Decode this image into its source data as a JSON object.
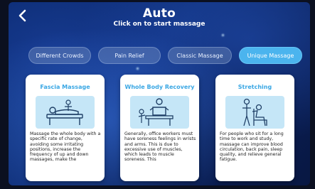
{
  "header": {
    "title": "Auto",
    "subtitle": "Click on to start massage",
    "back_icon": "chevron-left-icon"
  },
  "tabs": [
    {
      "label": "Different Crowds",
      "active": false
    },
    {
      "label": "Pain Relief",
      "active": false
    },
    {
      "label": "Classic Massage",
      "active": false
    },
    {
      "label": "Unique Massage",
      "active": true
    }
  ],
  "cards": [
    {
      "title": "Fascia Massage",
      "icon": "reclining-massage-icon",
      "description": "Massage the whole body with a specific rate of change, avoiding some irritating positions, increase the frequency of up and down massages, make the"
    },
    {
      "title": "Whole Body Recovery",
      "icon": "seated-massage-icon",
      "description": "Generally, office workers must have soreness feelings in wrists and arms. This is due to excessive use of muscles, which leads to muscle soreness. This"
    },
    {
      "title": "Stretching",
      "icon": "stretching-chair-icon",
      "description": "For people who sit for a long time to work and study, massage can improve blood circulation, back pain, sleep quality, and relieve general fatigue."
    }
  ],
  "colors": {
    "accent": "#4bb4ee",
    "card_title": "#3aa7e4",
    "background": "#0b2a6e"
  }
}
